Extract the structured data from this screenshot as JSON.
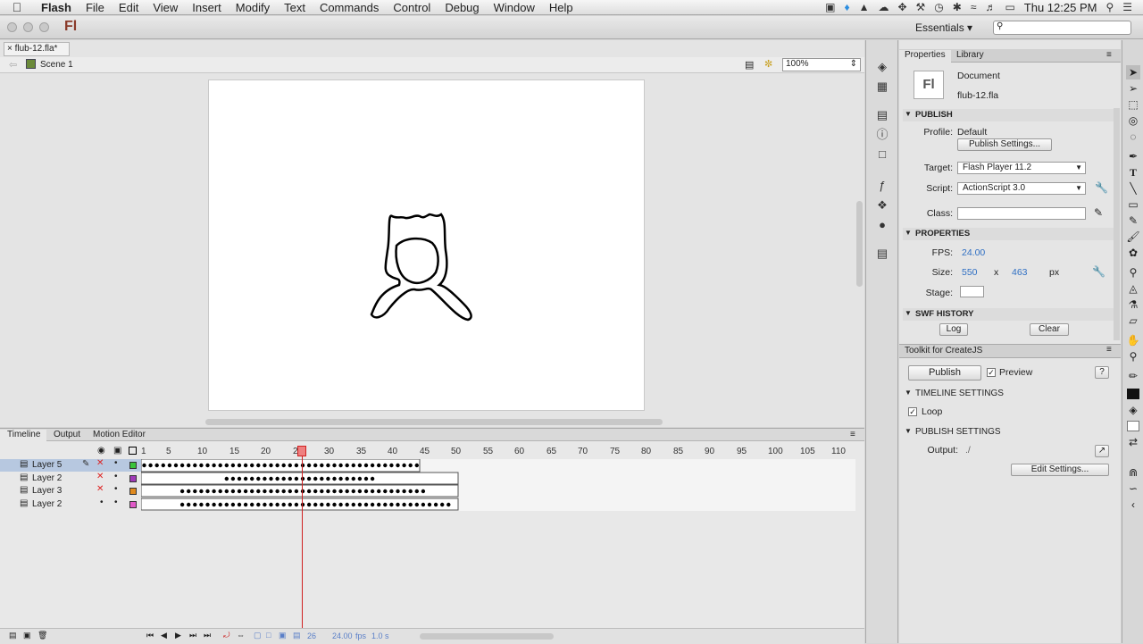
{
  "menubar": {
    "app": "Flash",
    "items": [
      "File",
      "Edit",
      "View",
      "Insert",
      "Modify",
      "Text",
      "Commands",
      "Control",
      "Debug",
      "Window",
      "Help"
    ],
    "clock": "Thu 12:25 PM"
  },
  "appbar": {
    "logo": "Fl",
    "workspace": "Essentials",
    "search_placeholder": ""
  },
  "document": {
    "tab": "flub-12.fla*",
    "scene": "Scene 1",
    "zoom": "100%"
  },
  "timeline": {
    "tabs": [
      "Timeline",
      "Output",
      "Motion Editor"
    ],
    "ruler": [
      "1",
      "5",
      "10",
      "15",
      "20",
      "25",
      "30",
      "35",
      "40",
      "45",
      "50",
      "55",
      "60",
      "65",
      "70",
      "75",
      "80",
      "85",
      "90",
      "95",
      "100",
      "105",
      "110"
    ],
    "layers": [
      "Layer 5",
      "Layer 2",
      "Layer 3",
      "Layer 2"
    ],
    "current_frame": "26",
    "fps": "24.00",
    "fps_unit": "fps",
    "time": "1.0 s"
  },
  "properties": {
    "tabs": [
      "Properties",
      "Library"
    ],
    "doc_type": "Document",
    "doc_name": "flub-12.fla",
    "sections": {
      "publish": "PUBLISH",
      "properties": "PROPERTIES",
      "swf_history": "SWF HISTORY"
    },
    "profile_label": "Profile:",
    "profile_value": "Default",
    "publish_settings_btn": "Publish Settings...",
    "target_label": "Target:",
    "target_value": "Flash Player 11.2",
    "script_label": "Script:",
    "script_value": "ActionScript 3.0",
    "class_label": "Class:",
    "fps_label": "FPS:",
    "fps_value": "24.00",
    "size_label": "Size:",
    "width": "550",
    "times": "x",
    "height": "463",
    "unit": "px",
    "stage_label": "Stage:",
    "log_btn": "Log",
    "clear_btn": "Clear"
  },
  "toolkit": {
    "title": "Toolkit for CreateJS",
    "publish_btn": "Publish",
    "preview_label": "Preview",
    "help_btn": "?",
    "timeline_settings": "TIMELINE SETTINGS",
    "loop_label": "Loop",
    "publish_settings": "PUBLISH SETTINGS",
    "output_label": "Output:",
    "output_value": "./",
    "edit_settings_btn": "Edit Settings..."
  },
  "colors": {
    "stage": "#ffffff",
    "playhead": "#d02020",
    "link": "#2f6fc3",
    "layer_colors": [
      "#39c339",
      "#a03ab8",
      "#e08a1f",
      "#e05ac8"
    ]
  }
}
